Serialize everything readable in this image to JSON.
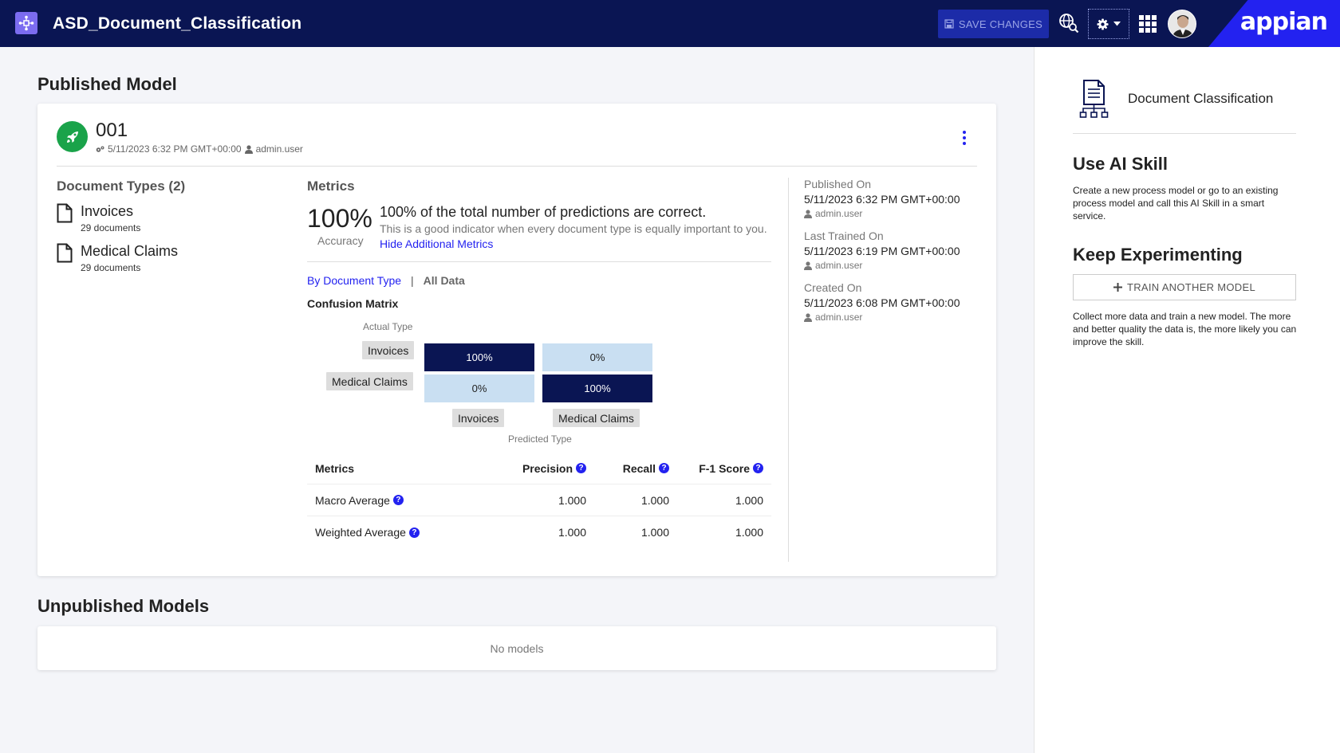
{
  "header": {
    "title": "ASD_Document_Classification",
    "save_label": "SAVE CHANGES",
    "brand": "appian"
  },
  "published": {
    "section_title": "Published Model",
    "model_id": "001",
    "timestamp": "5/11/2023 6:32 PM GMT+00:00",
    "user": "admin.user",
    "document_types_title": "Document Types (2)",
    "document_types": [
      {
        "name": "Invoices",
        "count": "29 documents"
      },
      {
        "name": "Medical Claims",
        "count": "29 documents"
      }
    ],
    "metrics_title": "Metrics",
    "accuracy_value": "100%",
    "accuracy_label": "Accuracy",
    "accuracy_headline": "100% of the total number of predictions are correct.",
    "accuracy_desc": "This is a good indicator when every document type is equally important to you.",
    "hide_link": "Hide Additional Metrics",
    "tab_by_type": "By Document Type",
    "tab_sep": "|",
    "tab_all": "All Data",
    "confusion_title": "Confusion Matrix",
    "actual_label": "Actual Type",
    "predicted_label": "Predicted Type",
    "row_labels": [
      "Invoices",
      "Medical Claims"
    ],
    "col_labels": [
      "Invoices",
      "Medical Claims"
    ],
    "cells": [
      [
        "100%",
        "0%"
      ],
      [
        "0%",
        "100%"
      ]
    ],
    "table": {
      "headers": [
        "Metrics",
        "Precision",
        "Recall",
        "F-1 Score"
      ],
      "rows": [
        [
          "Macro Average",
          "1.000",
          "1.000",
          "1.000"
        ],
        [
          "Weighted Average",
          "1.000",
          "1.000",
          "1.000"
        ]
      ]
    },
    "history": [
      {
        "label": "Published On",
        "value": "5/11/2023 6:32 PM GMT+00:00",
        "user": "admin.user"
      },
      {
        "label": "Last Trained On",
        "value": "5/11/2023 6:19 PM GMT+00:00",
        "user": "admin.user"
      },
      {
        "label": "Created On",
        "value": "5/11/2023 6:08 PM GMT+00:00",
        "user": "admin.user"
      }
    ]
  },
  "unpublished": {
    "section_title": "Unpublished Models",
    "empty_text": "No models"
  },
  "sidebar": {
    "title": "Document Classification",
    "use_title": "Use AI Skill",
    "use_desc": "Create a new process model or go to an existing process model and call this AI Skill in a smart service.",
    "keep_title": "Keep Experimenting",
    "train_label": "TRAIN ANOTHER MODEL",
    "keep_desc": "Collect more data and train a new model. The more and better quality the data is, the more likely you can improve the skill."
  },
  "colors": {
    "header_bg": "#0a1553",
    "accent": "#2322f0",
    "success": "#1aa34a",
    "matrix_dark": "#0a1553",
    "matrix_light": "#c9dff2"
  }
}
